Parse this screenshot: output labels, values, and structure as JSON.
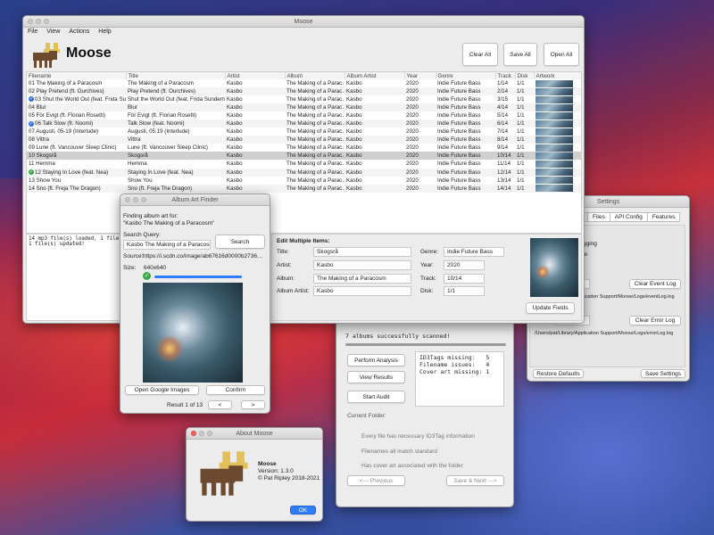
{
  "main": {
    "title": "Moose",
    "menu": [
      "File",
      "View",
      "Actions",
      "Help"
    ],
    "app_name": "Moose",
    "buttons": {
      "clear_all": "Clear All",
      "save_all": "Save All",
      "open_all": "Open All"
    },
    "columns": [
      "Filename",
      "Title",
      "Artist",
      "Album",
      "Album Artist",
      "Year",
      "Genre",
      "Track",
      "Disk",
      "Artwork"
    ],
    "rows": [
      {
        "filename": "01 The Making of a Paracosm",
        "title": "The Making of a Paracosm",
        "artist": "Kasbo",
        "album": "The Making of a Parac…",
        "album_artist": "Kasbo",
        "year": "2020",
        "genre": "Indie Future Bass",
        "track": "1/14",
        "disk": "1/1",
        "mark": ""
      },
      {
        "filename": "02 Play Pretend (ft. Ourchives)",
        "title": "Play Pretend (ft. Ourchives)",
        "artist": "Kasbo",
        "album": "The Making of a Parac…",
        "album_artist": "Kasbo",
        "year": "2020",
        "genre": "Indie Future Bass",
        "track": "2/14",
        "disk": "1/1",
        "mark": ""
      },
      {
        "filename": "03 Shut the World Out (feat. Frida Sunde…",
        "title": "Shut the World Out (feat. Frida Sundemo)",
        "artist": "Kasbo",
        "album": "The Making of a Parac…",
        "album_artist": "Kasbo",
        "year": "2020",
        "genre": "Indie Future Bass",
        "track": "3/15",
        "disk": "1/1",
        "mark": "blue"
      },
      {
        "filename": "04 Blur",
        "title": "Blur",
        "artist": "Kasbo",
        "album": "The Making of a Parac…",
        "album_artist": "Kasbo",
        "year": "2020",
        "genre": "Indie Future Bass",
        "track": "4/14",
        "disk": "1/1",
        "mark": ""
      },
      {
        "filename": "05 För Evigt (ft. Florian Rosetti)",
        "title": "För Evigt (ft. Florian Rosetti)",
        "artist": "Kasbo",
        "album": "The Making of a Parac…",
        "album_artist": "Kasbo",
        "year": "2020",
        "genre": "Indie Future Bass",
        "track": "5/14",
        "disk": "1/1",
        "mark": ""
      },
      {
        "filename": "06 Talk Slow (ft. Noomi)",
        "title": "Talk Slow (feat. Noomi)",
        "artist": "Kasbo",
        "album": "The Making of a Parac…",
        "album_artist": "Kasbo",
        "year": "2020",
        "genre": "Indie Future Bass",
        "track": "6/14",
        "disk": "1/1",
        "mark": "blue"
      },
      {
        "filename": "07 Augusti, 05-19 (Interlude)",
        "title": "Augusti, 05:19 (Interlude)",
        "artist": "Kasbo",
        "album": "The Making of a Parac…",
        "album_artist": "Kasbo",
        "year": "2020",
        "genre": "Indie Future Bass",
        "track": "7/14",
        "disk": "1/1",
        "mark": ""
      },
      {
        "filename": "08 Vittra",
        "title": "Vittra",
        "artist": "Kasbo",
        "album": "The Making of a Parac…",
        "album_artist": "Kasbo",
        "year": "2020",
        "genre": "Indie Future Bass",
        "track": "8/14",
        "disk": "1/1",
        "mark": ""
      },
      {
        "filename": "09 Lune (ft. Vancouver Sleep Clinic)",
        "title": "Lune (ft. Vancouver Sleep Clinic)",
        "artist": "Kasbo",
        "album": "The Making of a Parac…",
        "album_artist": "Kasbo",
        "year": "2020",
        "genre": "Indie Future Bass",
        "track": "9/14",
        "disk": "1/1",
        "mark": ""
      },
      {
        "filename": "10 Skogsrå",
        "title": "Skogsrå",
        "artist": "Kasbo",
        "album": "The Making of a Parac…",
        "album_artist": "Kasbo",
        "year": "2020",
        "genre": "Indie Future Bass",
        "track": "10/14",
        "disk": "1/1",
        "mark": ""
      },
      {
        "filename": "11 Hemma",
        "title": "Hemma",
        "artist": "Kasbo",
        "album": "The Making of a Parac…",
        "album_artist": "Kasbo",
        "year": "2020",
        "genre": "Indie Future Bass",
        "track": "11/14",
        "disk": "1/1",
        "mark": ""
      },
      {
        "filename": "12 Staying In Love (feat. Nea)",
        "title": "Staying In Love (feat. Nea)",
        "artist": "Kasbo",
        "album": "The Making of a Parac…",
        "album_artist": "Kasbo",
        "year": "2020",
        "genre": "Indie Future Bass",
        "track": "12/14",
        "disk": "1/1",
        "mark": "green"
      },
      {
        "filename": "13 Show You",
        "title": "Show You",
        "artist": "Kasbo",
        "album": "The Making of a Parac…",
        "album_artist": "Kasbo",
        "year": "2020",
        "genre": "Indie Future Bass",
        "track": "13/14",
        "disk": "1/1",
        "mark": ""
      },
      {
        "filename": "14 Sno (ft. Freja The Dragon)",
        "title": "Sno (ft. Freja The Dragon)",
        "artist": "Kasbo",
        "album": "The Making of a Parac…",
        "album_artist": "Kasbo",
        "year": "2020",
        "genre": "Indie Future Bass",
        "track": "14/14",
        "disk": "1/1",
        "mark": ""
      }
    ],
    "selected_row": 9,
    "console": [
      "14 mp3 file(s) loaded, 1 file was…",
      "1 file(s) updated!"
    ],
    "edit": {
      "heading": "Edit Multiple Items:",
      "title_label": "Title:",
      "title_value": "Skogsrå",
      "artist_label": "Artist:",
      "artist_value": "Kasbo",
      "album_label": "Album:",
      "album_value": "The Making of a Paracosm",
      "album_artist_label": "Album Artist:",
      "album_artist_value": "Kasbo",
      "genre_label": "Genre:",
      "genre_value": "Indie Future Bass",
      "year_label": "Year:",
      "year_value": "2020",
      "track_label": "Track:",
      "track_value": "10/14",
      "disk_label": "Disk:",
      "disk_value": "1/1",
      "update_button": "Update Fields"
    }
  },
  "art_finder": {
    "title": "Album Art Finder",
    "finding_label": "Finding album art for:",
    "finding_query": "\"Kasbo The Making of a Paracosm\"",
    "search_query_label": "Search Query:",
    "search_query_value": "Kasbo The Making of a Paracosm",
    "search_button": "Search",
    "source_label": "Source:",
    "source_value": "https://i.scdn.co/image/ab67616d0000b2736…",
    "size_label": "Size:",
    "size_value": "640x640",
    "progress": 1.0,
    "open_google_button": "Open Google Images",
    "confirm_button": "Confirm",
    "result_text": "Result 1 of 13",
    "prev_button": "<",
    "next_button": ">"
  },
  "auditor": {
    "scan_status": "7 albums successfully scanned!",
    "analysis_button": "Perform Analysis",
    "view_results_button": "View Results",
    "start_audit_button": "Start Audit",
    "report": [
      "ID3Tags missing:   5",
      "Filename issues:   4",
      "Cover art missing: 1"
    ],
    "current_folder_label": "Current Folder:",
    "checks": [
      "Every file has necessary ID3Tag information",
      "Filenames all match standard",
      "Has cover art associated with the folder"
    ],
    "previous_button": "<--- Previous",
    "save_next_button": "Save & Next --->"
  },
  "settings": {
    "title": "Settings",
    "tabs": [
      "Files",
      "API Config",
      "Features"
    ],
    "logging_partial": "gging",
    "le_partial": "le",
    "clear_event_log": "Clear Event Log",
    "event_log_path": "pplication Support/Moose/Logs/eventLog.log",
    "clear_error_log": "Clear Error Log",
    "error_log_path": "/Users/pat/Library/Application Support/Moose/Logs/errorLog.log",
    "restore_defaults": "Restore Defaults",
    "save_settings": "Save Settings"
  },
  "about": {
    "title": "About Moose",
    "app_name": "Moose",
    "version": "Version: 1.3.0",
    "copyright": "© Pat Ripley 2018-2021",
    "ok_button": "OK"
  },
  "colors": {
    "accent": "#2f7cf6",
    "moose_body": "#6b4a2f",
    "moose_antler": "#e3c15a"
  }
}
